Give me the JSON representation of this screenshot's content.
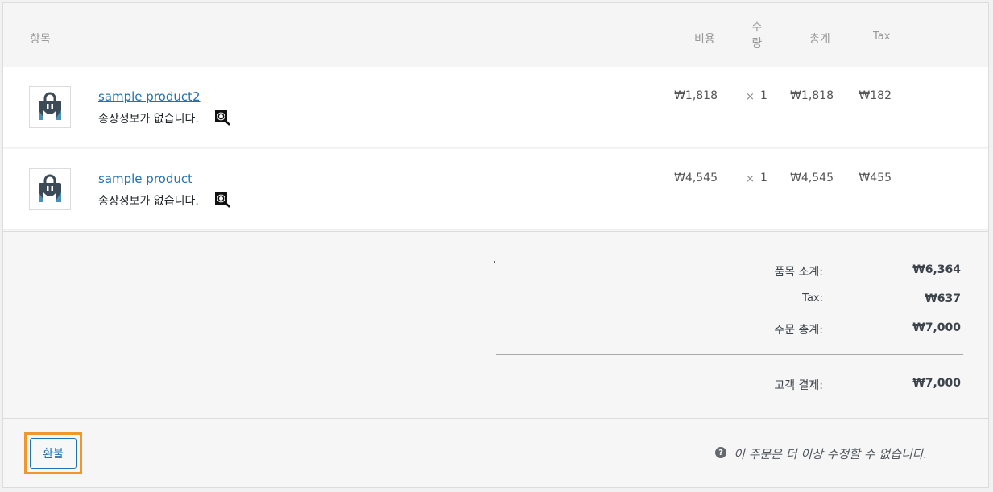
{
  "table_header": {
    "item": "항목",
    "cost": "비용",
    "qty_line1": "수",
    "qty_line2": "량",
    "total": "총계",
    "tax": "Tax"
  },
  "items": [
    {
      "name": "sample product2",
      "note": "송장정보가 없습니다.",
      "cost": "₩1,818",
      "qty_prefix": "×",
      "qty": "1",
      "total": "₩1,818",
      "tax": "₩182",
      "thumbnail_icon": "shopping-bag-icon",
      "note_icon": "search-receipt-icon"
    },
    {
      "name": "sample product",
      "note": "송장정보가 없습니다.",
      "cost": "₩4,545",
      "qty_prefix": "×",
      "qty": "1",
      "total": "₩4,545",
      "tax": "₩455",
      "thumbnail_icon": "shopping-bag-icon",
      "note_icon": "search-receipt-icon"
    }
  ],
  "totals": {
    "mark": "'",
    "subtotal_label": "품목 소계:",
    "subtotal_value": "₩6,364",
    "tax_label": "Tax:",
    "tax_value": "₩637",
    "order_total_label": "주문 총계:",
    "order_total_value": "₩7,000",
    "paid_label": "고객 결제:",
    "paid_value": "₩7,000"
  },
  "footer": {
    "refund_button": "환불",
    "help_icon": "question-circle-icon",
    "notice": "이 주문은 더 이상 수정할 수 없습니다."
  },
  "colors": {
    "link": "#2271b1",
    "highlight": "#f0962a",
    "bag_dark": "#3c4a57",
    "bag_accent": "#4a90b8"
  }
}
